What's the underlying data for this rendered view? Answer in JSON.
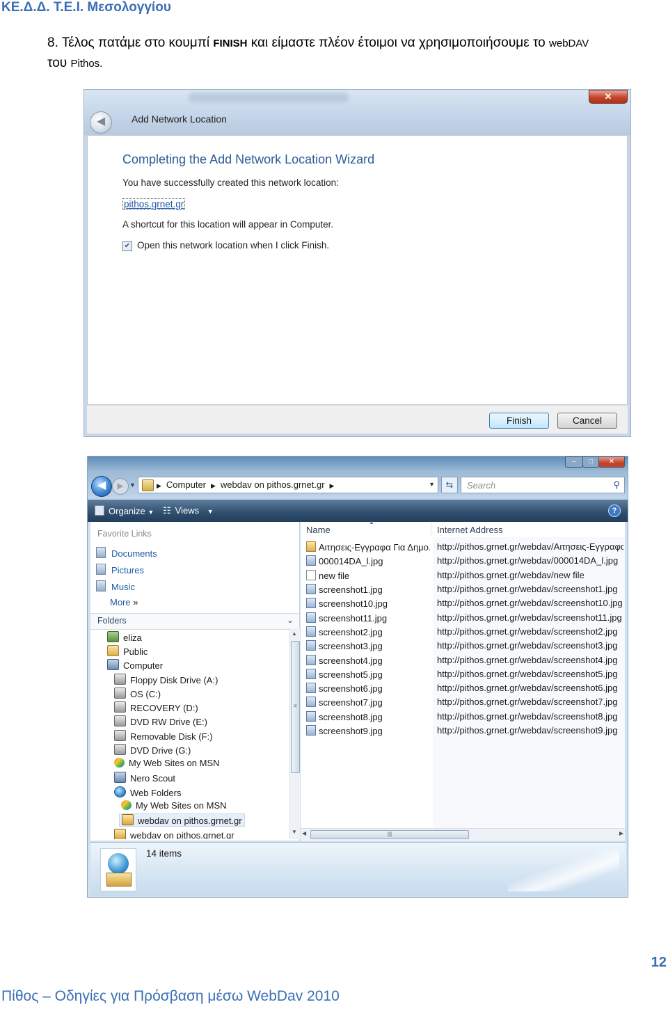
{
  "document": {
    "header": "ΚΕ.Δ.Δ.  Τ.Ε.Ι. Μεσολογγίου",
    "step_prefix": "8. Τέλος πατάμε στο κουμπί ",
    "step_bold": "FINISH",
    "step_middle": " και είμαστε πλέον έτοιμοι να χρησιμοποιήσουμε το ",
    "step_webdav": "webDAV",
    "step_tou": "του",
    "step_pithos": "Pithos.",
    "page_number": "12",
    "footer": "Πίθος – Οδηγίες  για Πρόσβαση  μέσω WebDav  2010"
  },
  "wizard": {
    "window_title": "Add Network Location",
    "heading": "Completing the Add Network Location Wizard",
    "success_text": "You have successfully created this network location:",
    "location_link": "pithos.grnet.gr",
    "shortcut_text": "A shortcut for this location will appear in Computer.",
    "checkbox_label": "Open this network location when I click Finish.",
    "checkbox_checked": true,
    "finish_label": "Finish",
    "cancel_label": "Cancel",
    "close_glyph": "✕"
  },
  "explorer": {
    "breadcrumb_root": "Computer",
    "breadcrumb_current": "webdav on pithos.grnet.gr",
    "search_placeholder": "Search",
    "toolbar": {
      "organize": "Organize",
      "views": "Views",
      "help": "?"
    },
    "favorite_links_heading": "Favorite Links",
    "favorites": [
      "Documents",
      "Pictures",
      "Music"
    ],
    "more_label": "More",
    "folders_heading": "Folders",
    "tree": [
      {
        "label": "eliza",
        "icon": "user-folder-icon",
        "indent": 0
      },
      {
        "label": "Public",
        "icon": "folder-icon",
        "indent": 0
      },
      {
        "label": "Computer",
        "icon": "computer-icon",
        "indent": 0
      },
      {
        "label": "Floppy Disk Drive (A:)",
        "icon": "floppy-drive-icon",
        "indent": 1
      },
      {
        "label": "OS (C:)",
        "icon": "hard-drive-icon",
        "indent": 1
      },
      {
        "label": "RECOVERY (D:)",
        "icon": "hard-drive-icon",
        "indent": 1
      },
      {
        "label": "DVD RW Drive (E:)",
        "icon": "dvd-drive-icon",
        "indent": 1
      },
      {
        "label": "Removable Disk (F:)",
        "icon": "removable-disk-icon",
        "indent": 1
      },
      {
        "label": "DVD Drive (G:)",
        "icon": "dvd-drive-icon",
        "indent": 1
      },
      {
        "label": "My Web Sites on MSN",
        "icon": "msn-icon",
        "indent": 1
      },
      {
        "label": "Nero Scout",
        "icon": "nero-scout-icon",
        "indent": 1
      },
      {
        "label": "Web Folders",
        "icon": "web-folders-icon",
        "indent": 1
      },
      {
        "label": "My Web Sites on MSN",
        "icon": "msn-icon",
        "indent": 2
      },
      {
        "label": "webdav on pithos.grnet.gr",
        "icon": "network-location-icon",
        "indent": 2,
        "selected": true
      },
      {
        "label": "webdav on pithos.grnet.gr",
        "icon": "network-location-icon",
        "indent": 1
      }
    ],
    "columns": {
      "name": "Name",
      "address": "Internet Address"
    },
    "files": [
      {
        "name": "Αιτησεις-Εγγραφα Για Δημο...",
        "address": "http://pithos.grnet.gr/webdav/Αιτησεις-Εγγραφα Γι",
        "type": "folder"
      },
      {
        "name": "000014DA_l.jpg",
        "address": "http://pithos.grnet.gr/webdav/000014DA_l.jpg",
        "type": "image"
      },
      {
        "name": "new file",
        "address": "http://pithos.grnet.gr/webdav/new file",
        "type": "file"
      },
      {
        "name": "screenshot1.jpg",
        "address": "http://pithos.grnet.gr/webdav/screenshot1.jpg",
        "type": "image"
      },
      {
        "name": "screenshot10.jpg",
        "address": "http://pithos.grnet.gr/webdav/screenshot10.jpg",
        "type": "image"
      },
      {
        "name": "screenshot11.jpg",
        "address": "http://pithos.grnet.gr/webdav/screenshot11.jpg",
        "type": "image"
      },
      {
        "name": "screenshot2.jpg",
        "address": "http://pithos.grnet.gr/webdav/screenshot2.jpg",
        "type": "image"
      },
      {
        "name": "screenshot3.jpg",
        "address": "http://pithos.grnet.gr/webdav/screenshot3.jpg",
        "type": "image"
      },
      {
        "name": "screenshot4.jpg",
        "address": "http://pithos.grnet.gr/webdav/screenshot4.jpg",
        "type": "image"
      },
      {
        "name": "screenshot5.jpg",
        "address": "http://pithos.grnet.gr/webdav/screenshot5.jpg",
        "type": "image"
      },
      {
        "name": "screenshot6.jpg",
        "address": "http://pithos.grnet.gr/webdav/screenshot6.jpg",
        "type": "image"
      },
      {
        "name": "screenshot7.jpg",
        "address": "http://pithos.grnet.gr/webdav/screenshot7.jpg",
        "type": "image"
      },
      {
        "name": "screenshot8.jpg",
        "address": "http://pithos.grnet.gr/webdav/screenshot8.jpg",
        "type": "image"
      },
      {
        "name": "screenshot9.jpg",
        "address": "http://pithos.grnet.gr/webdav/screenshot9.jpg",
        "type": "image"
      }
    ],
    "status_items": "14 items"
  }
}
